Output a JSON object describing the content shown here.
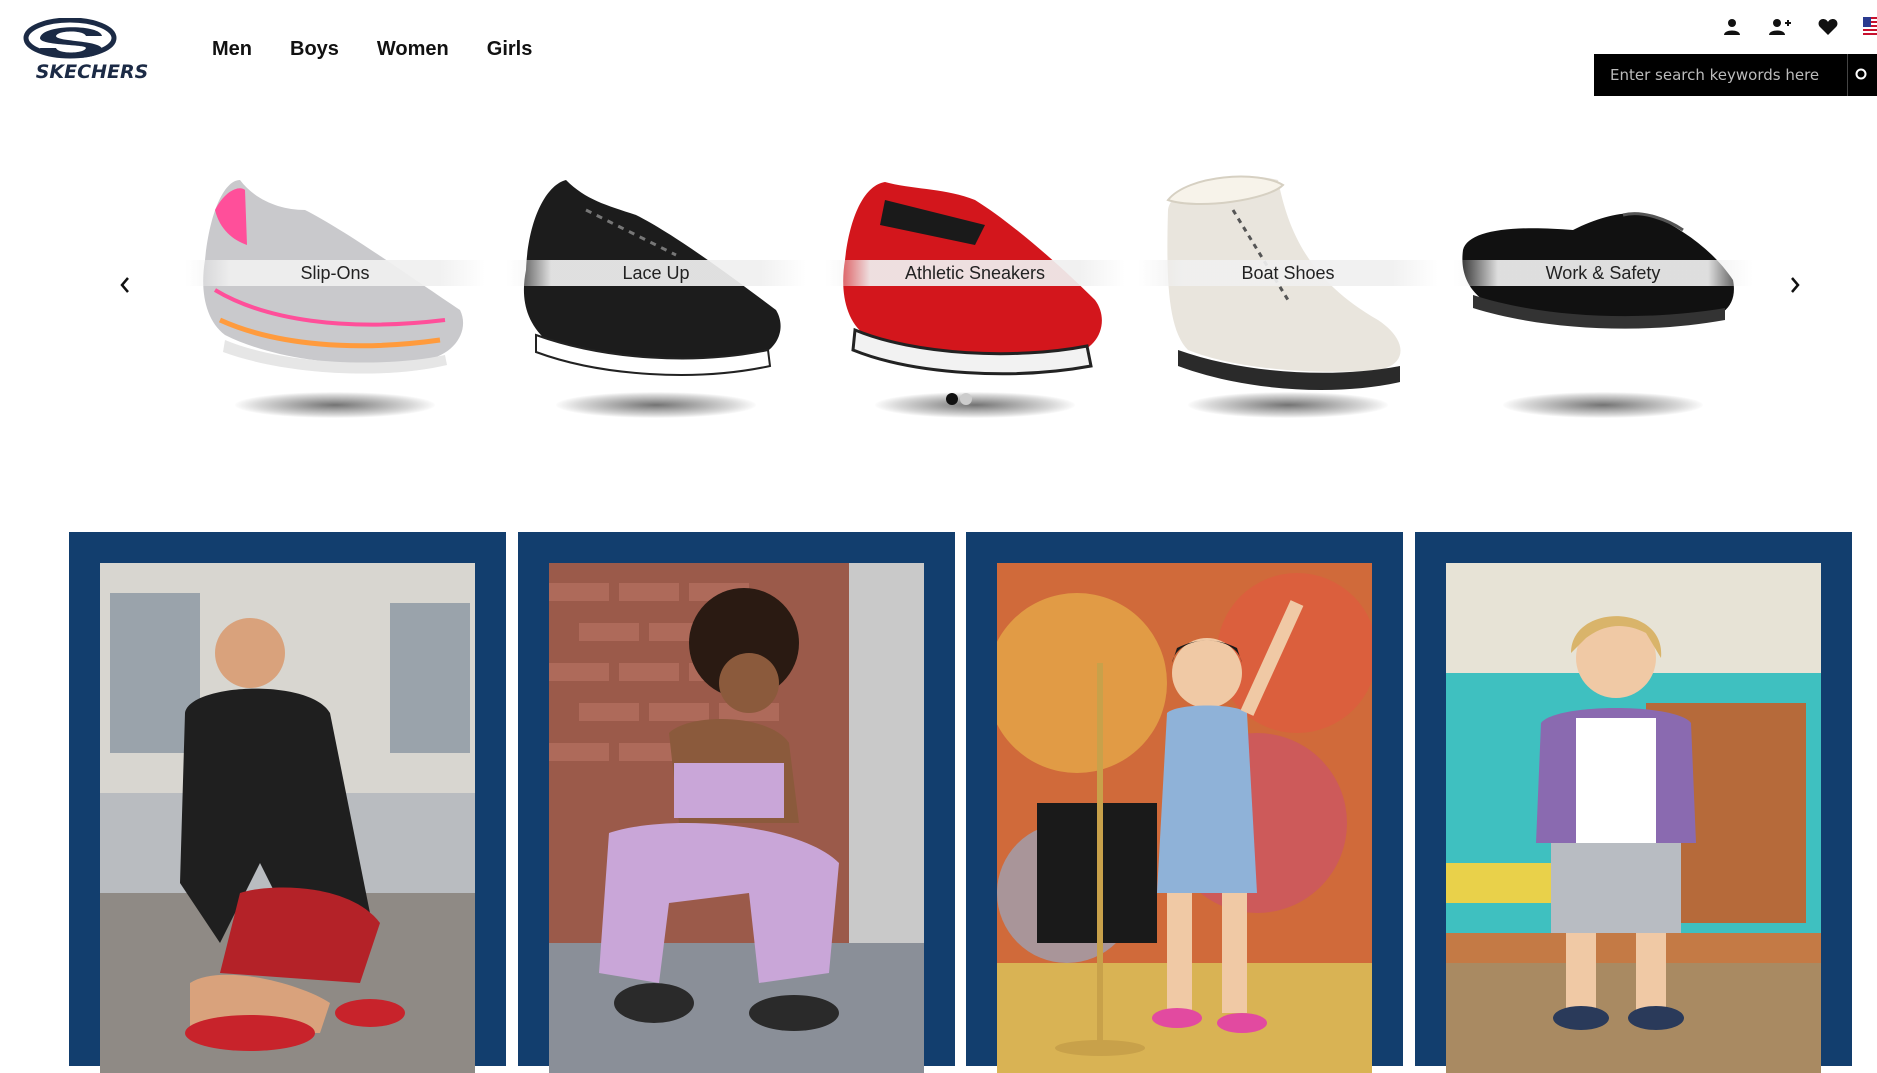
{
  "brand": {
    "logo_text": "SKECHERS",
    "colors": {
      "logo_dark": "#1b2a45",
      "tile_navy": "#123e6e"
    }
  },
  "nav": {
    "items": [
      "Men",
      "Boys",
      "Women",
      "Girls"
    ]
  },
  "utility_icons": [
    "account-icon",
    "add-user-icon",
    "heart-icon",
    "us-flag-icon"
  ],
  "search": {
    "placeholder": "Enter search keywords here",
    "icon": "search-icon"
  },
  "carousel": {
    "prev_icon": "chevron-left-icon",
    "next_icon": "chevron-right-icon",
    "slides": [
      {
        "label": "Slip-Ons",
        "shoe_color": "#c9c9cc",
        "accent": "#ff4f9a"
      },
      {
        "label": "Lace Up",
        "shoe_color": "#1c1c1c",
        "accent": "#ffffff"
      },
      {
        "label": "Athletic Sneakers",
        "shoe_color": "#d3161c",
        "accent": "#1a1a1a"
      },
      {
        "label": "Boat Shoes",
        "shoe_color": "#e9e5dd",
        "accent": "#2a2a2a"
      },
      {
        "label": "Work & Safety",
        "shoe_color": "#111111",
        "accent": "#333333"
      }
    ],
    "active_dot": 0,
    "dot_count": 2
  },
  "tiles": [
    {
      "subject": "man-tying-red-sneaker",
      "palette": [
        "#9aa3ab",
        "#1f1f1f",
        "#c8232b"
      ]
    },
    {
      "subject": "woman-lavender-outfit-brick-wall",
      "palette": [
        "#9b5a4a",
        "#c9a6d8",
        "#2a2a2a"
      ]
    },
    {
      "subject": "girl-microphone-tie-dye",
      "palette": [
        "#d06a3a",
        "#8fb2d8",
        "#e24aa0"
      ]
    },
    {
      "subject": "boy-vintage-van",
      "palette": [
        "#3fc0c0",
        "#c47a45",
        "#8a6ab0"
      ]
    }
  ]
}
